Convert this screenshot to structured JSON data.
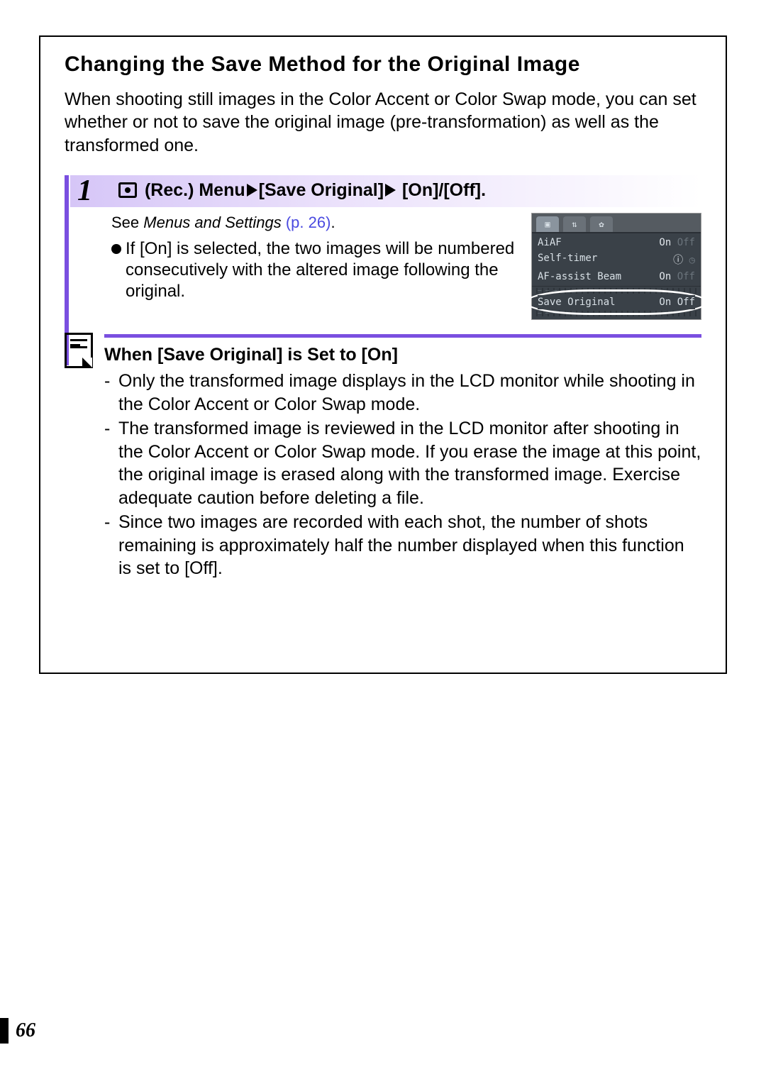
{
  "title": "Changing the Save Method for the Original Image",
  "intro": "When shooting still images in the Color Accent or Color Swap mode, you can set whether or not to save the original image (pre-transformation) as well as the transformed one.",
  "step": {
    "number": "1",
    "menu_prefix": "(Rec.) Menu",
    "menu_item": "[Save Original]",
    "menu_values": "[On]/[Off].",
    "see_label": "See ",
    "see_ref": "Menus and Settings",
    "see_page": "(p. 26)",
    "see_suffix": ".",
    "bullet": "If [On] is selected, the two images will be numbered consecutively with the altered image following the original."
  },
  "camera_menu": {
    "tabs": [
      "camera",
      "tools",
      "setup"
    ],
    "rows": [
      {
        "label": "AiAF",
        "on": "On",
        "off": "Off"
      },
      {
        "label": "Self-timer",
        "icon": "timer"
      },
      {
        "label": "AF-assist Beam",
        "on": "On",
        "off": "Off"
      }
    ],
    "highlight": {
      "label": "Save Original",
      "on": "On",
      "off": "Off",
      "selected": "Off"
    }
  },
  "note": {
    "heading": "When [Save Original] is Set to [On]",
    "items": [
      "Only the transformed image displays in the LCD monitor while shooting in the Color Accent or Color Swap mode.",
      "The transformed image is reviewed in the LCD monitor after shooting in the Color Accent or Color Swap mode. If you erase the image at this point, the original image is erased along with the transformed image. Exercise adequate caution before deleting a file.",
      "Since two images are recorded with each shot, the number of shots remaining is approximately half the number displayed when this function is set to [Off]."
    ]
  },
  "page_number": "66"
}
